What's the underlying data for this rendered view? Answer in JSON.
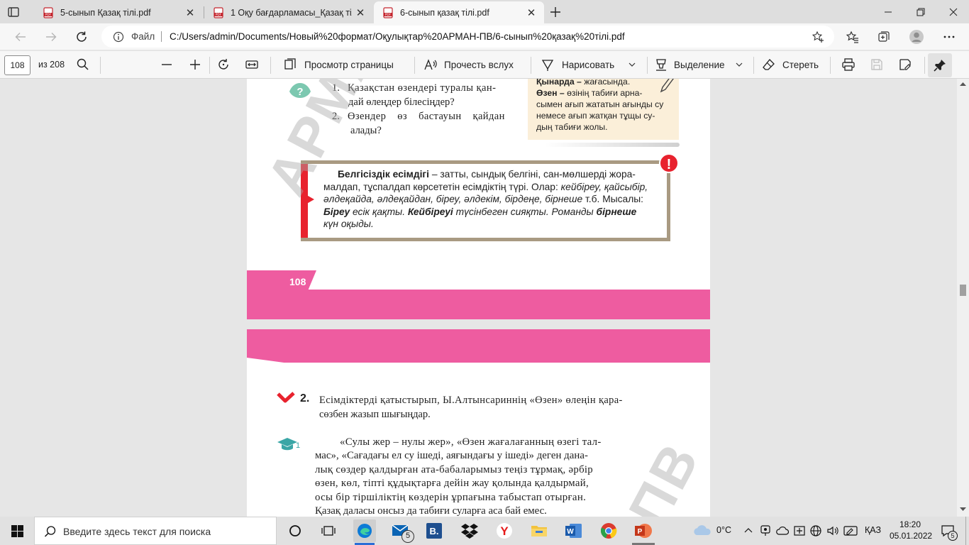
{
  "tabs": [
    {
      "title": "5-сынып Қазақ тілі.pdf",
      "active": false
    },
    {
      "title": "1 Оқу бағдарламасы_Қазақ тілі 5",
      "active": false
    },
    {
      "title": "6-сынып қазақ тілі.pdf",
      "active": true
    }
  ],
  "address": {
    "scheme_label": "Файл",
    "url": "C:/Users/admin/Documents/Новый%20формат/Оқулықтар%20АРМАН-ПВ/6-сынып%20қазақ%20тілі.pdf"
  },
  "pdf_toolbar": {
    "page_current": "108",
    "page_total": "из 208",
    "page_view": "Просмотр страницы",
    "read_aloud": "Прочесть вслух",
    "draw": "Нарисовать",
    "highlight": "Выделение",
    "erase": "Стереть"
  },
  "page108": {
    "q1_num": "1.",
    "q1_l1": "Қазақстан өзендері туралы қан-",
    "q1_l2": "дай өлеңдер білесіңдер?",
    "q2_num": "2.",
    "q2_l1": "Өзендер өз бастауын қайдан",
    "q2_l2": "алады?",
    "note_l1_bold": "Қынарда –",
    "note_l1_rest": " жағасында.",
    "note_l2_bold": "Өзен –",
    "note_l2_rest": " өзінің табиғи арна-",
    "note_l3": "сымен ағып жататын ағынды су",
    "note_l4": "немесе ағып жатқан тұщы су-",
    "note_l5": "дың табиғи жолы.",
    "rule_l1_bold": "Белгісіздік есімдігі",
    "rule_l1_rest": " – затты, сындық белгіні, сан-мөлшерді жора-",
    "rule_l2a": "малдап, тұспалдап көрсететін есімдіктің түрі. Олар: ",
    "rule_l2b": "кейбіреу, қайсыбір,",
    "rule_l3a": "әлдеқайда, әлдеқайдан, біреу, әлдекім, бірдеңе, бірнеше",
    "rule_l3b": " т.б. Мысалы:",
    "rule_l4a": "Біреу",
    "rule_l4b": " есік қақты. ",
    "rule_l4c": "Кейбіреуі",
    "rule_l4d": " түсінбеген сияқты. Романды ",
    "rule_l4e": "бірнеше",
    "rule_l5": "күн оқыды.",
    "alert_mark": "!",
    "page_number": "108",
    "watermark": "АРМАН"
  },
  "page109": {
    "task_num": "2.",
    "task_l1": "Есімдіктерді қатыстырып, Ы.Алтынсариннің «Өзен» өлеңін қара-",
    "task_l2": "сөзбен жазып шығыңдар.",
    "cap_index": "1",
    "text_lines": [
      "«Сулы жер – нулы жер», «Өзен жағалағанның өзегі тал-",
      "мас», «Сағадағы ел су ішеді, аяғындағы у ішеді» деген дана-",
      "лық сөздер қалдырған ата-бабаларымыз теңіз тұрмақ, әрбір",
      "өзен, көл, тіпті құдықтарға дейін жау қолында қалдырмай,",
      "осы бір тіршіліктің көздерін ұрпағына табыстап отырған.",
      "Қазақ даласы онсыз да табиғи суларға аса бай емес."
    ],
    "watermark": "ПВ"
  },
  "taskbar": {
    "search_placeholder": "Введите здесь текст для поиска",
    "mail_badge": "5",
    "teams_badge": "5",
    "temperature": "0°C",
    "language": "ҚАЗ",
    "time": "18:20",
    "date": "05.01.2022",
    "notif_count": "5"
  },
  "colors": {
    "accent_pink": "#ee5ca0",
    "alert_red": "#e8222e",
    "rule_border": "#a99a82",
    "note_bg": "#fbefd9",
    "cap_teal": "#3aa6a6"
  }
}
